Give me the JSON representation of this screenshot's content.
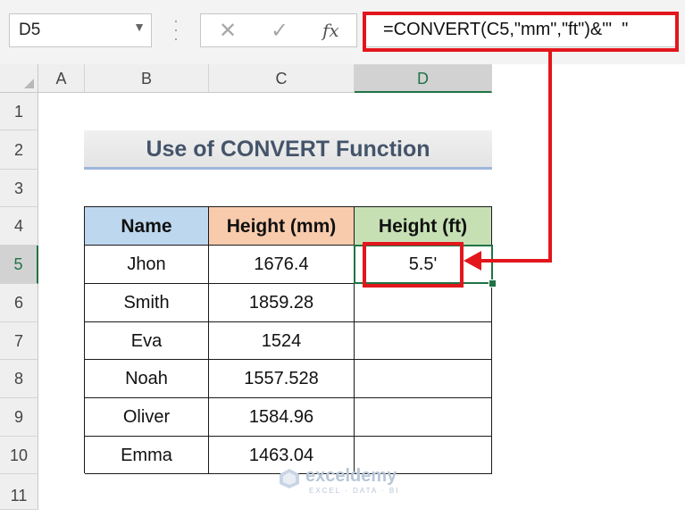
{
  "formula_bar": {
    "name_box": "D5",
    "cancel_icon": "✕",
    "enter_icon": "✓",
    "fx_label": "fx",
    "formula": "=CONVERT(C5,\"mm\",\"ft\")&\"'  \""
  },
  "columns": [
    "A",
    "B",
    "C",
    "D"
  ],
  "rows": [
    "1",
    "2",
    "3",
    "4",
    "5",
    "6",
    "7",
    "8",
    "9",
    "10",
    "11"
  ],
  "title": "Use of CONVERT Function",
  "table": {
    "headers": {
      "name": "Name",
      "mm": "Height (mm)",
      "ft": "Height (ft)"
    },
    "rows": [
      {
        "name": "Jhon",
        "mm": "1676.4",
        "ft": "5.5'"
      },
      {
        "name": "Smith",
        "mm": "1859.28",
        "ft": ""
      },
      {
        "name": "Eva",
        "mm": "1524",
        "ft": ""
      },
      {
        "name": "Noah",
        "mm": "1557.528",
        "ft": ""
      },
      {
        "name": "Oliver",
        "mm": "1584.96",
        "ft": ""
      },
      {
        "name": "Emma",
        "mm": "1463.04",
        "ft": ""
      }
    ]
  },
  "watermark": {
    "name": "exceldemy",
    "tagline": "EXCEL · DATA · BI"
  },
  "colors": {
    "excel_green": "#217346",
    "annotation_red": "#e3161c",
    "name_header": "#bdd7ee",
    "mm_header": "#f8cbad",
    "ft_header": "#c6e0b4"
  }
}
